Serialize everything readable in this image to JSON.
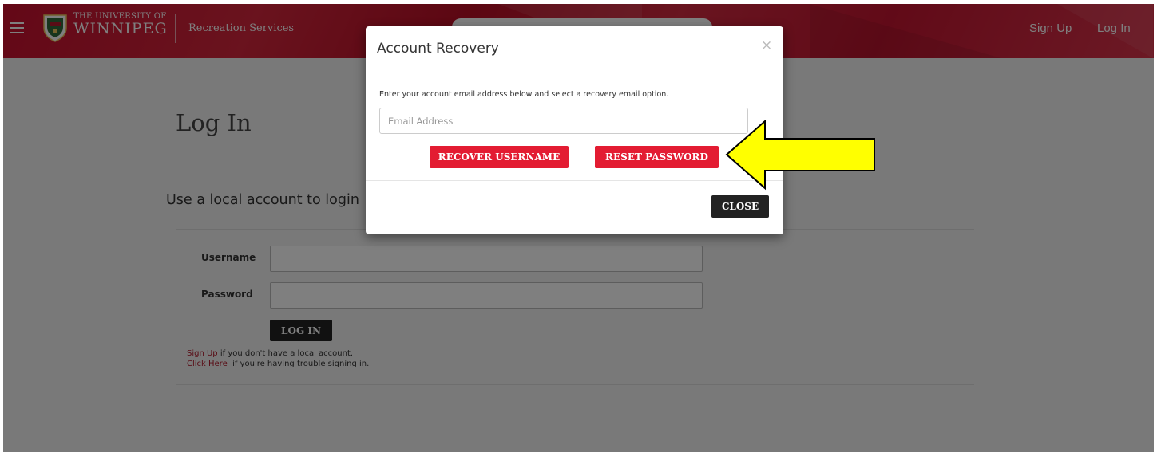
{
  "header": {
    "menu_icon": "hamburger-menu-icon",
    "brand_top": "THE UNIVERSITY OF",
    "brand_name": "WINNIPEG",
    "service_name": "Recreation Services",
    "nav": {
      "signup": "Sign Up",
      "login": "Log In"
    },
    "colors": {
      "brand": "#c8102e"
    }
  },
  "page": {
    "title": "Log In",
    "subtitle": "Use a local account to login",
    "username_label": "Username",
    "password_label": "Password",
    "login_button": "LOG IN",
    "help": {
      "signup_link": "Sign Up",
      "signup_text": " if you don't have a local account.",
      "trouble_link": "Click Here",
      "trouble_text": "  if you're having trouble signing in."
    }
  },
  "modal": {
    "title": "Account Recovery",
    "close_icon": "×",
    "instructions": "Enter your account email address below and select a recovery email option.",
    "email_placeholder": "Email Address",
    "email_value": "",
    "recover_username": "RECOVER USERNAME",
    "reset_password": "RESET PASSWORD",
    "close_button": "CLOSE",
    "colors": {
      "action": "#e31c32",
      "dark": "#222222"
    }
  },
  "annotation": {
    "icon": "arrow-left-icon",
    "color": "#ffff00"
  }
}
